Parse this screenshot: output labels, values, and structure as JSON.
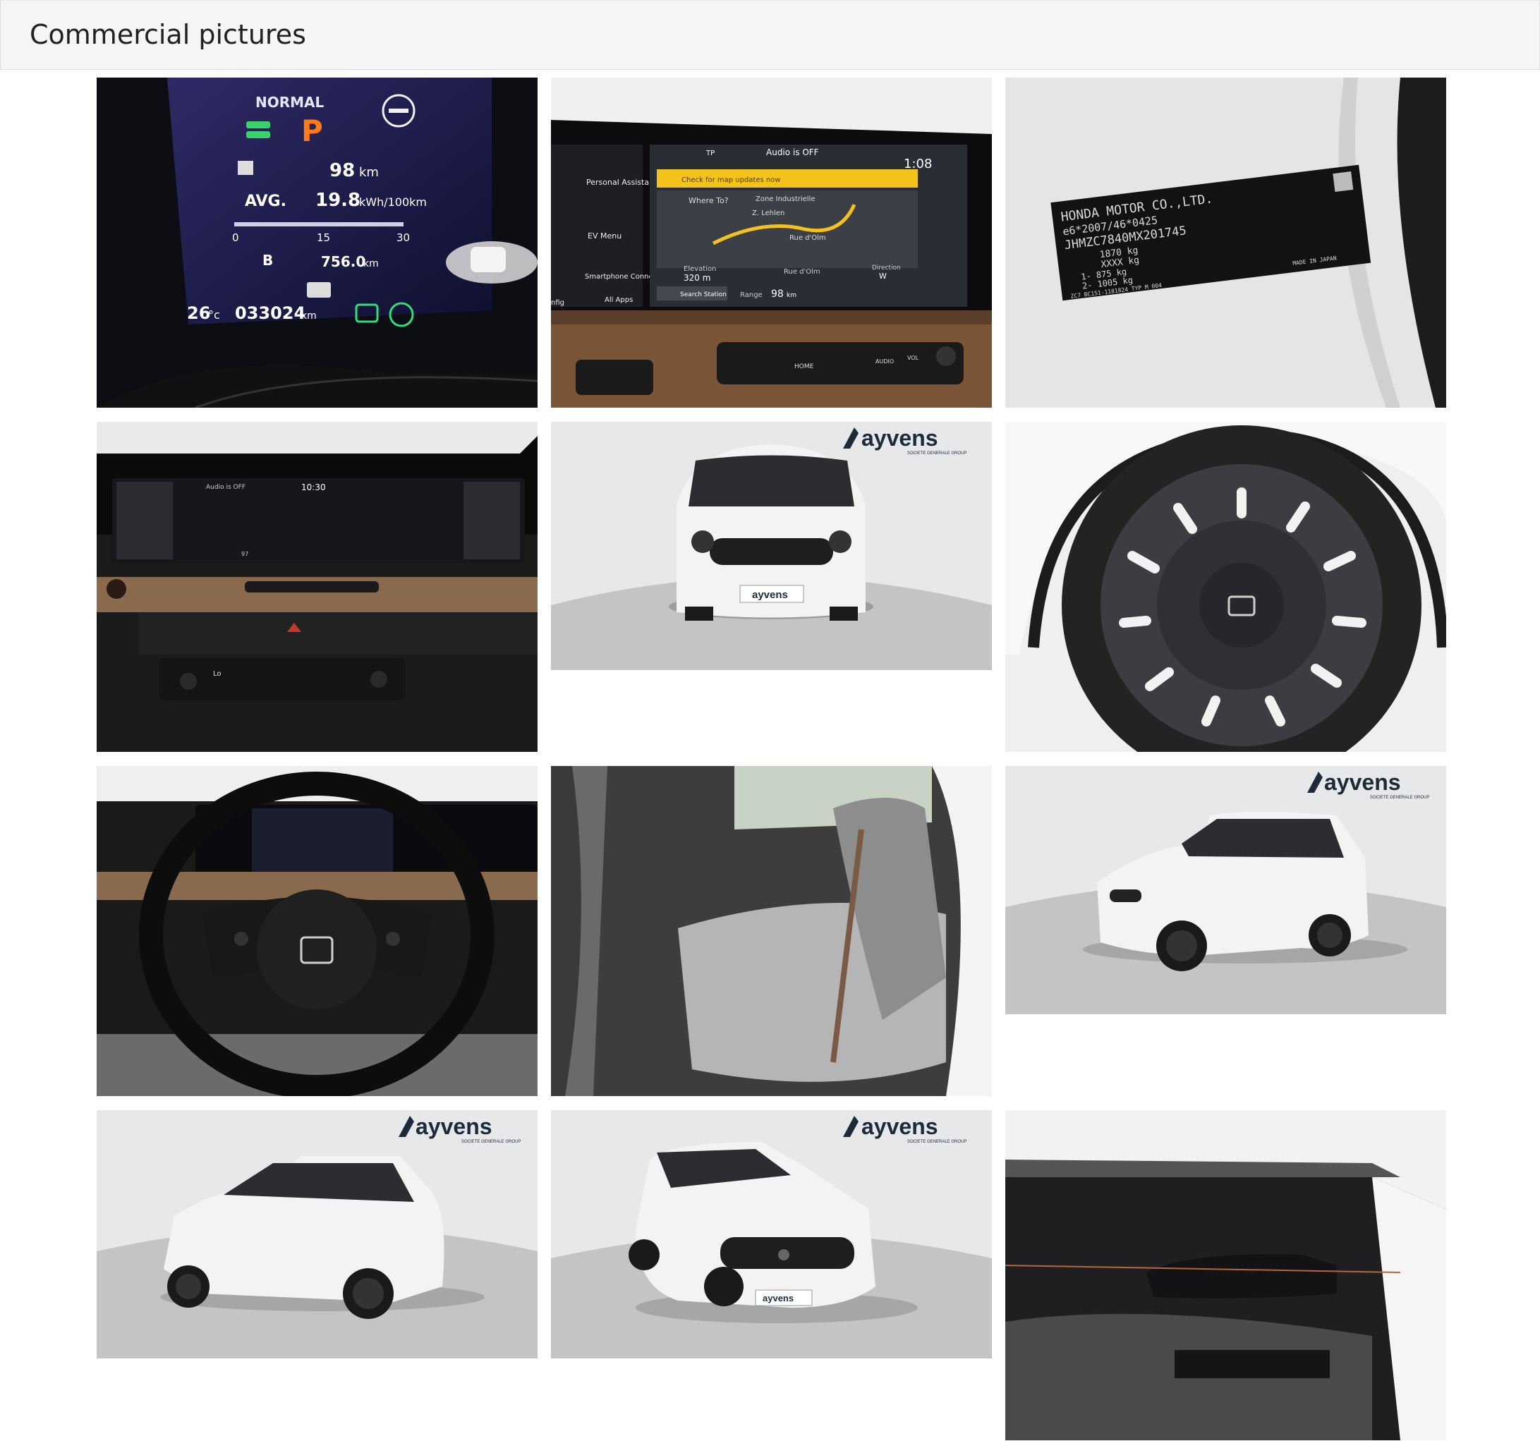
{
  "header": {
    "title": "Commercial pictures"
  },
  "brand": {
    "logo_text": "ayvens",
    "logo_sub": "SOCIETE GENERALE GROUP",
    "plate_text": "ayvens"
  },
  "photos": {
    "cluster": {
      "mode": "NORMAL",
      "gear": "P",
      "range": "98",
      "range_unit": "km",
      "avg_label": "AVG.",
      "avg_value": "19.8",
      "avg_unit": "kWh/100km",
      "scale_0": "0",
      "scale_15": "15",
      "scale_30": "30",
      "trip_label": "B",
      "trip_value": "756.0",
      "trip_unit": "km",
      "temp": "26",
      "temp_unit": "°c",
      "odometer": "033024",
      "odo_unit": "km"
    },
    "nav_screen": {
      "audio": "Audio is OFF",
      "clock": "1:08",
      "tp": "TP",
      "banner": "Check for map updates now",
      "where_to": "Where To?",
      "zone": "Zone Industrielle",
      "town": "Z. Lehlen",
      "street": "Rue d'Olm",
      "personal_assistant": "Personal Assistant",
      "ev_menu": "EV Menu",
      "smartphone": "Smartphone Connection",
      "all_apps": "All Apps",
      "config": "nfig",
      "elevation_label": "Elevation",
      "elevation_value": "320 m",
      "road_label": "Rue d'Olm",
      "direction_label": "Direction",
      "direction_value": "W",
      "search_station": "Search Station",
      "range_label": "Range",
      "range_value": "98",
      "range_unit": "km",
      "home": "HOME",
      "audio_btn": "AUDIO",
      "vol": "VOL"
    },
    "vin_plate": {
      "line1": "HONDA MOTOR CO.,LTD.",
      "line2": "e6*2007/46*0425",
      "line3": "JHMZC7840MX201745",
      "line4": "1870 kg",
      "line5": "XXXX kg",
      "line6": "1-  875 kg",
      "line7": "2-  1005 kg",
      "line8": "ZC7 BC151-1181824  TYP M  004",
      "made_in": "MADE IN JAPAN"
    },
    "dash_screen": {
      "audio": "Audio is OFF",
      "clock": "10:30",
      "range": "97",
      "temp": "Lo"
    }
  }
}
